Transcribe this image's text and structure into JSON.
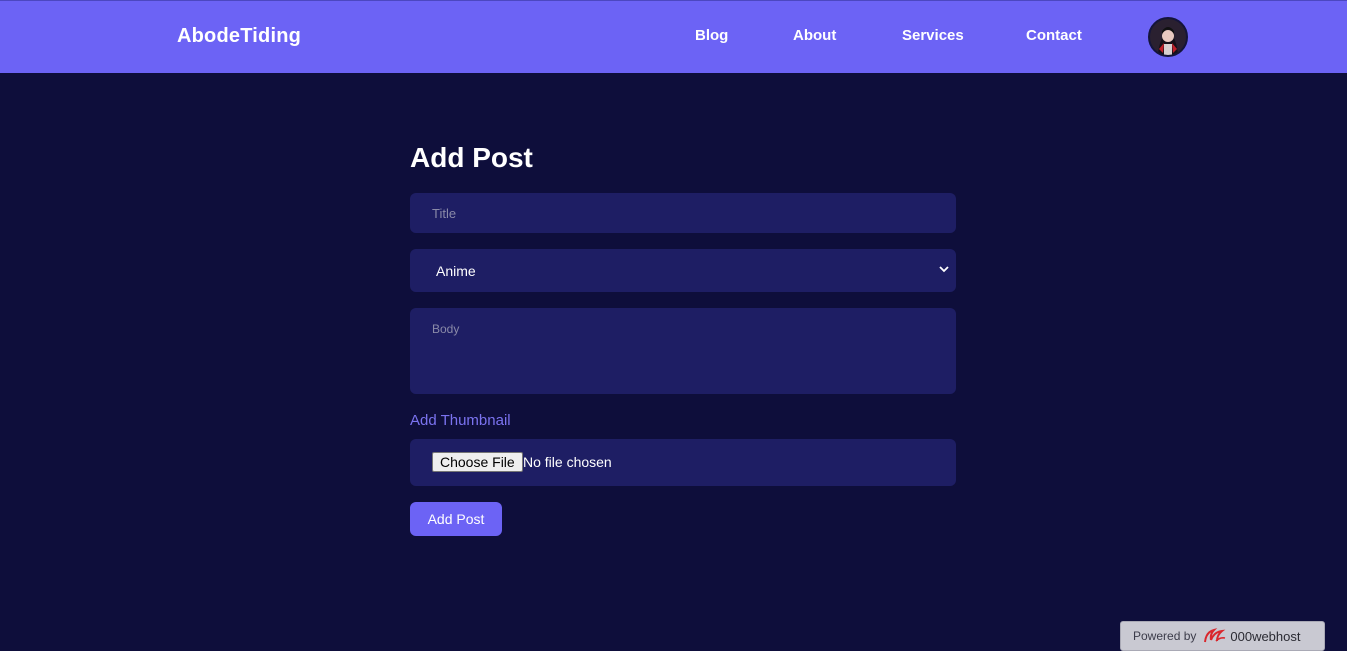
{
  "header": {
    "logo": "AbodeTiding",
    "nav": [
      {
        "label": "Blog"
      },
      {
        "label": "About"
      },
      {
        "label": "Services"
      },
      {
        "label": "Contact"
      }
    ]
  },
  "form": {
    "heading": "Add Post",
    "title_placeholder": "Title",
    "category_selected": "Anime",
    "body_placeholder": "Body",
    "thumbnail_label": "Add Thumbnail",
    "choose_file_label": "Choose File",
    "file_status": "No file chosen",
    "submit_label": "Add Post"
  },
  "footer_badge": {
    "powered_by": "Powered by",
    "brand": "000webhost"
  },
  "colors": {
    "background": "#0e0e3b",
    "accent": "#6c63f5",
    "field": "#1e1e64"
  }
}
